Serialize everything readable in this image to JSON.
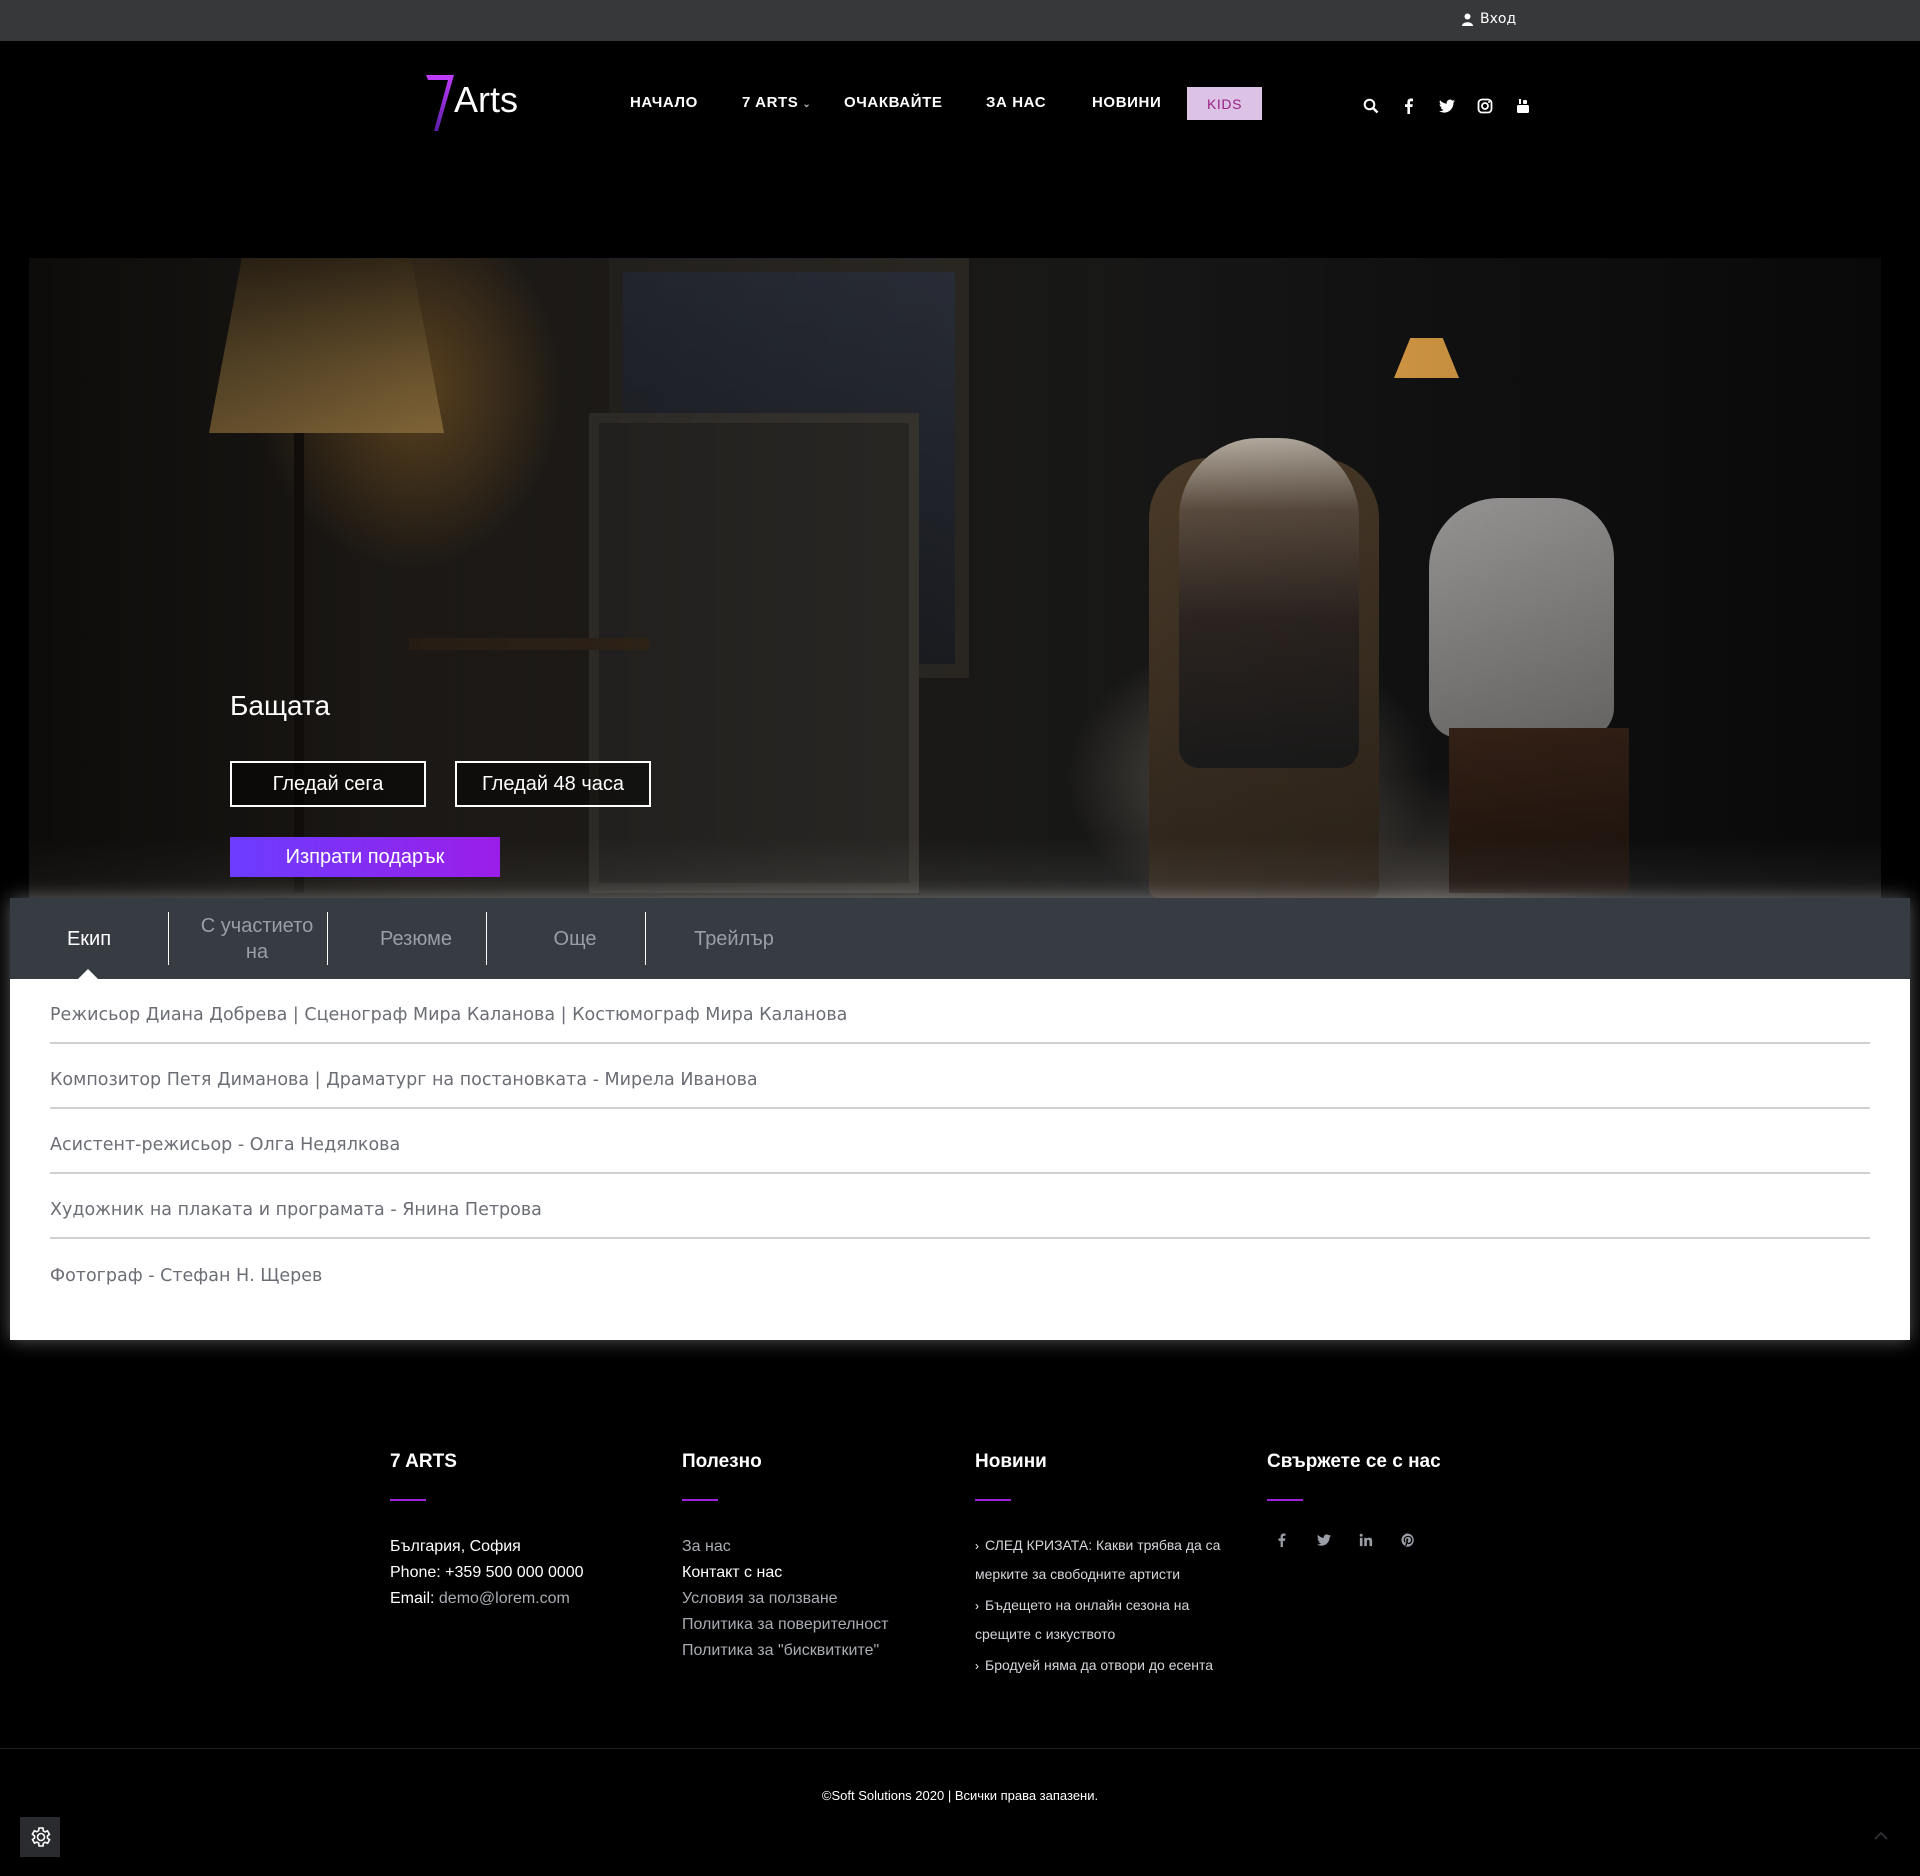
{
  "topbar": {
    "login_label": "Вход"
  },
  "header": {
    "logo_text": "Arts",
    "nav": [
      {
        "label": "НАЧАЛО"
      },
      {
        "label": "7 ARTS",
        "has_dropdown": true
      },
      {
        "label": "ОЧАКВАЙТЕ"
      },
      {
        "label": "ЗА НАС"
      },
      {
        "label": "НОВИНИ"
      }
    ],
    "kids_label": "KIDS",
    "social": [
      "search-icon",
      "facebook-icon",
      "twitter-icon",
      "instagram-icon",
      "youtube-icon"
    ]
  },
  "hero": {
    "title": "Бащата",
    "watch_now": "Гледай сега",
    "watch_48h": "Гледай 48 часа",
    "send_gift": "Изпрати подарък"
  },
  "tabs": [
    {
      "label": "Екип",
      "active": true
    },
    {
      "label": "С участието на",
      "active": false
    },
    {
      "label": "Резюме",
      "active": false
    },
    {
      "label": "Още",
      "active": false
    },
    {
      "label": "Трейлър",
      "active": false
    }
  ],
  "crew": [
    "Режисьор Диана Добрева | Сценограф Мира Каланова | Костюмограф Мира Каланова",
    "Композитор Петя Диманова | Драматург на постановката - Мирела Иванова",
    "Асистент-режисьор - Олга Недялкова",
    "Художник на плаката и програмата - Янина Петрова",
    "Фотограф - Стефан Н. Щерев"
  ],
  "footer": {
    "about": {
      "heading": "7 ARTS",
      "address": "България, София",
      "phone_label": "Phone:",
      "phone": "+359 500 000 0000",
      "email_label": "Email:",
      "email": "demo@lorem.com"
    },
    "useful": {
      "heading": "Полезно",
      "links": [
        {
          "label": "За нас",
          "highlight": false
        },
        {
          "label": "Контакт с нас",
          "highlight": true
        },
        {
          "label": "Условия за ползване",
          "highlight": false
        },
        {
          "label": "Политика за поверителност",
          "highlight": false
        },
        {
          "label": "Политика за \"бисквитките\"",
          "highlight": false
        }
      ]
    },
    "news": {
      "heading": "Новини",
      "items": [
        "СЛЕД КРИЗАТА: Какви трябва да са мерките за свободните артисти",
        "Бъдещето на онлайн сезона на срещите с изкуството",
        "Бродуей няма да отвори до есента"
      ]
    },
    "contact": {
      "heading": "Свържете се с нас",
      "social": [
        "facebook-icon",
        "twitter-icon",
        "linkedin-icon",
        "pinterest-icon"
      ]
    },
    "copyright": "©Soft Solutions 2020 | Всички права запазени."
  },
  "colors": {
    "accent": "#9b22d6",
    "kids_bg": "#dcc3e6",
    "gift_from": "#6c3cff",
    "gift_to": "#9b1ee8",
    "tabs_bg": "#373b42"
  }
}
